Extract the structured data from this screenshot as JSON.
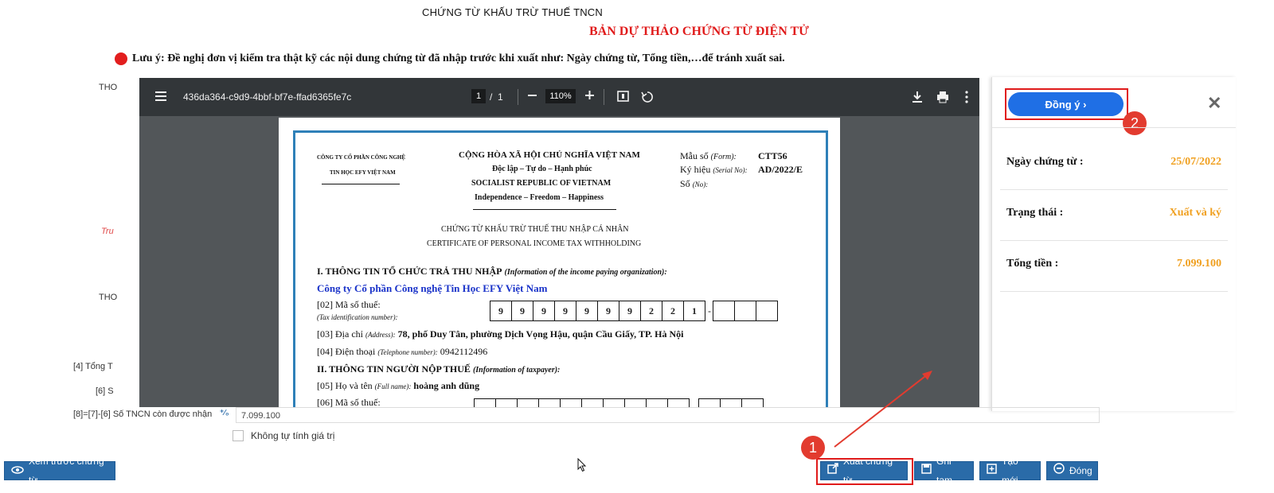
{
  "header": {
    "title": "CHỨNG TỪ KHẤU TRỪ THUẾ TNCN",
    "draft": "BẢN DỰ THẢO CHỨNG TỪ ĐIỆN TỬ",
    "note": "Lưu ý: Đề nghị đơn vị kiểm tra thật kỹ các nội dung chứng từ đã nhập trước khi xuất như: Ngày chứng từ, Tổng tiền,…để tránh xuất sai."
  },
  "background": {
    "labels": [
      "THO",
      "Tru",
      "THO",
      "[4] Tổng T",
      "[6] S"
    ],
    "row8_label": "[8]=[7]-[6] Số TNCN còn được nhận",
    "row8_value": "7.099.100",
    "checkbox_label": "Không tự tính giá trị"
  },
  "viewer": {
    "file_name": "436da364-c9d9-4bbf-bf7e-ffad6365fe7c",
    "page_current": "1",
    "page_sep": "/",
    "page_total": "1",
    "zoom": "110%"
  },
  "doc": {
    "company_header_1": "CÔNG TY CỔ PHẦN CÔNG NGHỆ",
    "company_header_2": "TIN HỌC EFY VIỆT NAM",
    "nation_1": "CỘNG HÒA XÃ HỘI CHỦ NGHĨA VIỆT NAM",
    "nation_2": "Độc lập – Tự do – Hạnh phúc",
    "nation_3": "SOCIALIST REPUBLIC OF VIETNAM",
    "nation_4": "Independence – Freedom – Happiness",
    "form_label": "Mẫu số",
    "form_label_en": "(Form):",
    "form_value": "CTT56",
    "serial_label": "Ký hiệu",
    "serial_label_en": "(Serial No):",
    "serial_value": "AD/2022/E",
    "no_label": "Số",
    "no_label_en": "(No):",
    "title_vn": "CHỨNG TỪ KHẤU TRỪ THUẾ THU NHẬP CÁ NHÂN",
    "title_en": "CERTIFICATE OF PERSONAL INCOME TAX WITHHOLDING",
    "sec1": "I. THÔNG TIN TỔ CHỨC TRẢ THU NHẬP",
    "sec1_en": "(Information of the income paying organization):",
    "company_name": "Công ty Cổ phần Công nghệ Tin Học EFY Việt Nam",
    "tax_label": "[02] Mã số thuế:",
    "tax_label_en": "(Tax identification number):",
    "tax_digits": [
      "9",
      "9",
      "9",
      "9",
      "9",
      "9",
      "9",
      "2",
      "2",
      "1"
    ],
    "tax_dash": "-",
    "addr_label": "[03] Địa chỉ",
    "addr_label_en": "(Address):",
    "addr_value": "78, phố Duy Tân, phường Dịch Vọng Hậu, quận Cầu Giấy, TP. Hà Nội",
    "phone_label": "[04] Điện thoại",
    "phone_label_en": "(Telephone number):",
    "phone_value": "0942112496",
    "sec2": "II. THÔNG TIN NGƯỜI NỘP THUẾ",
    "sec2_en": "(Information of taxpayer):",
    "name_label": "[05] Họ và tên",
    "name_label_en": "(Full name):",
    "name_value": "hoàng anh dũng",
    "tax2_label": "[06] Mã số thuế:"
  },
  "panel": {
    "agree_label": "Đồng ý",
    "badge_2": "2",
    "rows": [
      {
        "label": "Ngày chứng từ :",
        "value": "25/07/2022"
      },
      {
        "label": "Trạng thái :",
        "value": "Xuất và ký"
      },
      {
        "label": "Tổng tiền :",
        "value": "7.099.100"
      }
    ]
  },
  "buttons": {
    "preview": "Xem trước chứng từ",
    "export": "Xuất chứng từ",
    "save_draft": "Ghi tạm",
    "create_new": "Tạo mới",
    "close": "Đóng",
    "badge_1": "1"
  },
  "colors": {
    "accent_blue": "#1f6fe5",
    "button_blue": "#2a6ba8",
    "highlight_red": "#e01b1b",
    "value_orange": "#f0a020"
  }
}
